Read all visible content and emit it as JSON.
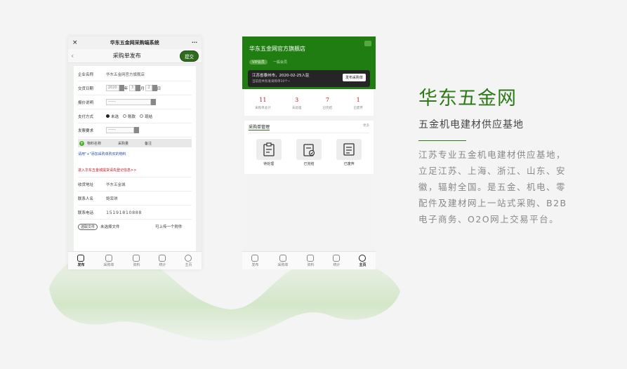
{
  "colors": {
    "brand_green": "#2e7a19",
    "header_green": "#1f7d12",
    "stat_red": "#c1121f",
    "link_blue": "#2a4fb3"
  },
  "phone1": {
    "window_title": "华东五金网采购端系统",
    "close_icon": "×",
    "more_icon": "···",
    "nav_title": "采购单发布",
    "back_icon": "‹",
    "submit_label": "提交",
    "company_label": "企业名称",
    "company_value": "华东五金网官方旗舰店",
    "date_label": "交货日期",
    "date_year": "2020",
    "date_year_unit": "年",
    "date_month": "3",
    "date_month_unit": "月",
    "date_day": "2",
    "date_day_unit": "日",
    "quote_label": "报价说明",
    "quote_value": "------",
    "pay_label": "支付方式",
    "pay_options": [
      "未选",
      "账款",
      "现结"
    ],
    "invoice_label": "发票要求",
    "invoice_value": "------",
    "table_cols": [
      "物料名称",
      "采购量",
      "备注"
    ],
    "add_hint": "请用\"+\"添加采购单购买的物料",
    "warn_text": "进入华东五金城提货请先登记信息>>",
    "addr_label": "收货地址",
    "addr_value": "华东五金城",
    "contact_label": "联系人名",
    "contact_value": "鲍荣琪",
    "phone_label": "联系电话",
    "phone_value": "15191810888",
    "choose_file_label": "选取文件",
    "no_file_text": "未选择文件",
    "upload_hint": "可上传一个附件",
    "tabs": [
      "发布",
      "采购单",
      "资料",
      "统计",
      "主页"
    ]
  },
  "phone2": {
    "store_name": "华东五金网官方旗舰店",
    "tag_label": "VIP会员",
    "tag_suffix": "一般会员",
    "banner_line1": "江苏省泰州市，2020-02-25入驻",
    "banner_line2": "当前您共有发采购单10个~",
    "publish_label": "发布采购单",
    "stats": [
      {
        "num": "11",
        "label": "采购单总计"
      },
      {
        "num": "3",
        "label": "未处理"
      },
      {
        "num": "7",
        "label": "已完结"
      },
      {
        "num": "1",
        "label": "已废弃"
      }
    ],
    "mgmt_title": "采购单管理",
    "mgmt_more": "更多",
    "mgmt_items": [
      "待处理",
      "已完结",
      "已废弃"
    ],
    "tabs": [
      "发布",
      "采购单",
      "资料",
      "统计",
      "主页"
    ]
  },
  "right": {
    "title": "华东五金网",
    "subtitle": "五金机电建材供应基地",
    "description": "江苏专业五金机电建材供应基地，立足江苏、上海、浙江、山东、安徽，辐射全国。是五金、机电、零配件及建材网上一站式采购、B2B电子商务、O2O网上交易平台。"
  }
}
